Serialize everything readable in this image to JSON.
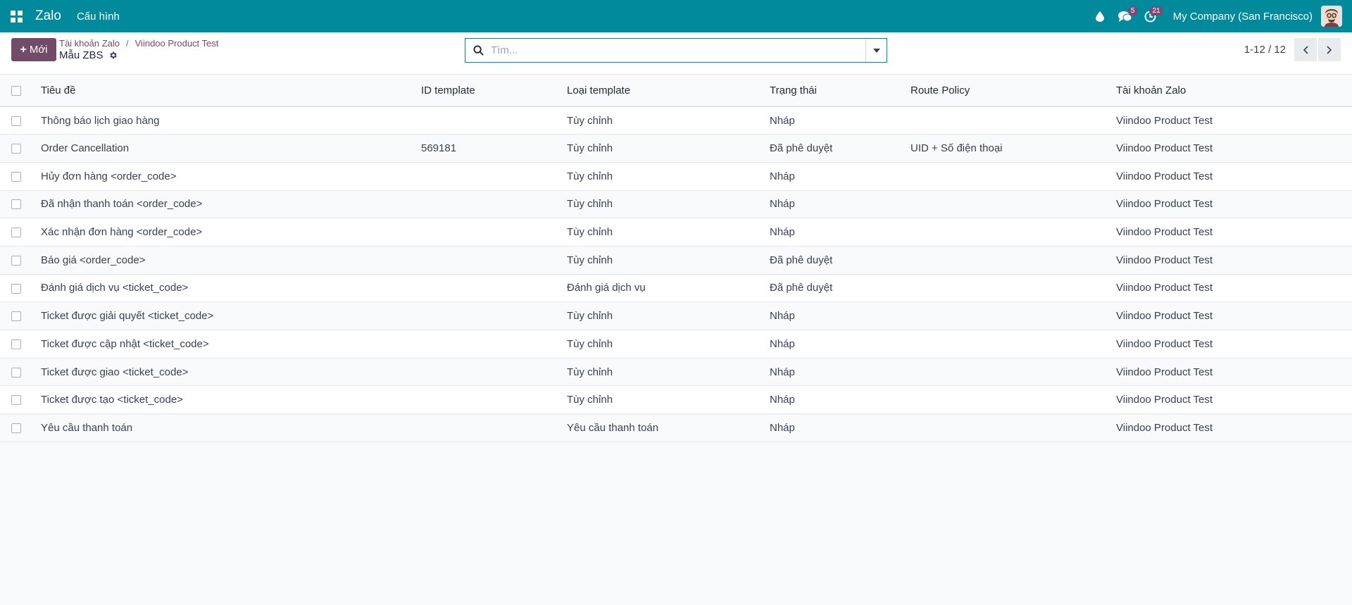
{
  "navbar": {
    "app_name": "Zalo",
    "menu": [
      "Cấu hình"
    ],
    "messages_badge": "5",
    "activities_badge": "21",
    "company": "My Company (San Francisco)",
    "color": "#018a9b"
  },
  "control": {
    "new_label": "Mới",
    "breadcrumb": [
      "Tài khoản Zalo",
      "Viindoo Product Test"
    ],
    "title": "Mẫu ZBS",
    "search_placeholder": "Tìm...",
    "pager": "1-12 / 12"
  },
  "table": {
    "columns": [
      "Tiêu đề",
      "ID template",
      "Loại template",
      "Trạng thái",
      "Route Policy",
      "Tài khoản Zalo"
    ],
    "rows": [
      [
        "Thông báo lịch giao hàng",
        "",
        "Tùy chỉnh",
        "Nháp",
        "",
        "Viindoo Product Test"
      ],
      [
        "Order Cancellation",
        "569181",
        "Tùy chỉnh",
        "Đã phê duyệt",
        "UID + Số điện thoại",
        "Viindoo Product Test"
      ],
      [
        "Hủy đơn hàng <order_code>",
        "",
        "Tùy chỉnh",
        "Nháp",
        "",
        "Viindoo Product Test"
      ],
      [
        "Đã nhận thanh toán <order_code>",
        "",
        "Tùy chỉnh",
        "Nháp",
        "",
        "Viindoo Product Test"
      ],
      [
        "Xác nhận đơn hàng <order_code>",
        "",
        "Tùy chỉnh",
        "Nháp",
        "",
        "Viindoo Product Test"
      ],
      [
        "Báo giá <order_code>",
        "",
        "Tùy chỉnh",
        "Đã phê duyệt",
        "",
        "Viindoo Product Test"
      ],
      [
        "Đánh giá dịch vụ <ticket_code>",
        "",
        "Đánh giá dịch vụ",
        "Đã phê duyệt",
        "",
        "Viindoo Product Test"
      ],
      [
        "Ticket được giải quyết <ticket_code>",
        "",
        "Tùy chỉnh",
        "Nháp",
        "",
        "Viindoo Product Test"
      ],
      [
        "Ticket được cập nhật <ticket_code>",
        "",
        "Tùy chỉnh",
        "Nháp",
        "",
        "Viindoo Product Test"
      ],
      [
        "Ticket được giao <ticket_code>",
        "",
        "Tùy chỉnh",
        "Nháp",
        "",
        "Viindoo Product Test"
      ],
      [
        "Ticket được tạo <ticket_code>",
        "",
        "Tùy chỉnh",
        "Nháp",
        "",
        "Viindoo Product Test"
      ],
      [
        "Yêu cầu thanh toán",
        "",
        "Yêu cầu thanh toán",
        "Nháp",
        "",
        "Viindoo Product Test"
      ]
    ]
  }
}
